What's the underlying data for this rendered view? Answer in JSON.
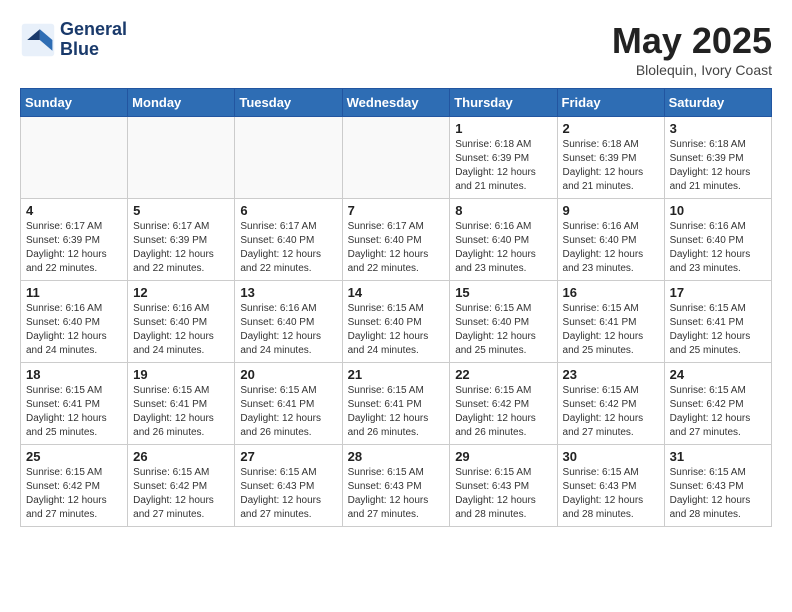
{
  "header": {
    "logo_line1": "General",
    "logo_line2": "Blue",
    "month": "May 2025",
    "location": "Blolequin, Ivory Coast"
  },
  "days_of_week": [
    "Sunday",
    "Monday",
    "Tuesday",
    "Wednesday",
    "Thursday",
    "Friday",
    "Saturday"
  ],
  "weeks": [
    [
      {
        "day": "",
        "info": ""
      },
      {
        "day": "",
        "info": ""
      },
      {
        "day": "",
        "info": ""
      },
      {
        "day": "",
        "info": ""
      },
      {
        "day": "1",
        "info": "Sunrise: 6:18 AM\nSunset: 6:39 PM\nDaylight: 12 hours\nand 21 minutes."
      },
      {
        "day": "2",
        "info": "Sunrise: 6:18 AM\nSunset: 6:39 PM\nDaylight: 12 hours\nand 21 minutes."
      },
      {
        "day": "3",
        "info": "Sunrise: 6:18 AM\nSunset: 6:39 PM\nDaylight: 12 hours\nand 21 minutes."
      }
    ],
    [
      {
        "day": "4",
        "info": "Sunrise: 6:17 AM\nSunset: 6:39 PM\nDaylight: 12 hours\nand 22 minutes."
      },
      {
        "day": "5",
        "info": "Sunrise: 6:17 AM\nSunset: 6:39 PM\nDaylight: 12 hours\nand 22 minutes."
      },
      {
        "day": "6",
        "info": "Sunrise: 6:17 AM\nSunset: 6:40 PM\nDaylight: 12 hours\nand 22 minutes."
      },
      {
        "day": "7",
        "info": "Sunrise: 6:17 AM\nSunset: 6:40 PM\nDaylight: 12 hours\nand 22 minutes."
      },
      {
        "day": "8",
        "info": "Sunrise: 6:16 AM\nSunset: 6:40 PM\nDaylight: 12 hours\nand 23 minutes."
      },
      {
        "day": "9",
        "info": "Sunrise: 6:16 AM\nSunset: 6:40 PM\nDaylight: 12 hours\nand 23 minutes."
      },
      {
        "day": "10",
        "info": "Sunrise: 6:16 AM\nSunset: 6:40 PM\nDaylight: 12 hours\nand 23 minutes."
      }
    ],
    [
      {
        "day": "11",
        "info": "Sunrise: 6:16 AM\nSunset: 6:40 PM\nDaylight: 12 hours\nand 24 minutes."
      },
      {
        "day": "12",
        "info": "Sunrise: 6:16 AM\nSunset: 6:40 PM\nDaylight: 12 hours\nand 24 minutes."
      },
      {
        "day": "13",
        "info": "Sunrise: 6:16 AM\nSunset: 6:40 PM\nDaylight: 12 hours\nand 24 minutes."
      },
      {
        "day": "14",
        "info": "Sunrise: 6:15 AM\nSunset: 6:40 PM\nDaylight: 12 hours\nand 24 minutes."
      },
      {
        "day": "15",
        "info": "Sunrise: 6:15 AM\nSunset: 6:40 PM\nDaylight: 12 hours\nand 25 minutes."
      },
      {
        "day": "16",
        "info": "Sunrise: 6:15 AM\nSunset: 6:41 PM\nDaylight: 12 hours\nand 25 minutes."
      },
      {
        "day": "17",
        "info": "Sunrise: 6:15 AM\nSunset: 6:41 PM\nDaylight: 12 hours\nand 25 minutes."
      }
    ],
    [
      {
        "day": "18",
        "info": "Sunrise: 6:15 AM\nSunset: 6:41 PM\nDaylight: 12 hours\nand 25 minutes."
      },
      {
        "day": "19",
        "info": "Sunrise: 6:15 AM\nSunset: 6:41 PM\nDaylight: 12 hours\nand 26 minutes."
      },
      {
        "day": "20",
        "info": "Sunrise: 6:15 AM\nSunset: 6:41 PM\nDaylight: 12 hours\nand 26 minutes."
      },
      {
        "day": "21",
        "info": "Sunrise: 6:15 AM\nSunset: 6:41 PM\nDaylight: 12 hours\nand 26 minutes."
      },
      {
        "day": "22",
        "info": "Sunrise: 6:15 AM\nSunset: 6:42 PM\nDaylight: 12 hours\nand 26 minutes."
      },
      {
        "day": "23",
        "info": "Sunrise: 6:15 AM\nSunset: 6:42 PM\nDaylight: 12 hours\nand 27 minutes."
      },
      {
        "day": "24",
        "info": "Sunrise: 6:15 AM\nSunset: 6:42 PM\nDaylight: 12 hours\nand 27 minutes."
      }
    ],
    [
      {
        "day": "25",
        "info": "Sunrise: 6:15 AM\nSunset: 6:42 PM\nDaylight: 12 hours\nand 27 minutes."
      },
      {
        "day": "26",
        "info": "Sunrise: 6:15 AM\nSunset: 6:42 PM\nDaylight: 12 hours\nand 27 minutes."
      },
      {
        "day": "27",
        "info": "Sunrise: 6:15 AM\nSunset: 6:43 PM\nDaylight: 12 hours\nand 27 minutes."
      },
      {
        "day": "28",
        "info": "Sunrise: 6:15 AM\nSunset: 6:43 PM\nDaylight: 12 hours\nand 27 minutes."
      },
      {
        "day": "29",
        "info": "Sunrise: 6:15 AM\nSunset: 6:43 PM\nDaylight: 12 hours\nand 28 minutes."
      },
      {
        "day": "30",
        "info": "Sunrise: 6:15 AM\nSunset: 6:43 PM\nDaylight: 12 hours\nand 28 minutes."
      },
      {
        "day": "31",
        "info": "Sunrise: 6:15 AM\nSunset: 6:43 PM\nDaylight: 12 hours\nand 28 minutes."
      }
    ]
  ]
}
